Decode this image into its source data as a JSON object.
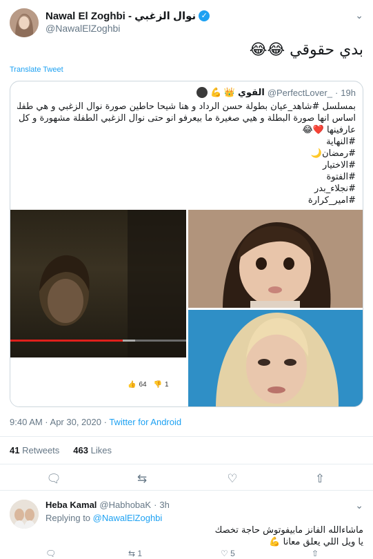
{
  "tweet": {
    "author_name": "Nawal El Zoghbi - نوال الزغبي",
    "handle": "@NawalElZoghbi",
    "text": "بدي حقوقي 😂😂",
    "translate_label": "Translate Tweet",
    "time": "9:40 AM · Apr 30, 2020",
    "source": "Twitter for Android",
    "retweets": "41",
    "retweets_label": "Retweets",
    "likes": "463",
    "likes_label": "Likes"
  },
  "quote": {
    "name": "القوي",
    "badges": "💪 👑",
    "handle": "@PerfectLover_",
    "time": "19h",
    "lines": [
      "بمسلسل #شاهد_عيان بطولة حسن الرداد و هنا شيحا حاطين صورة نوال الزغبي و هي طفلة ع",
      "اساس انها صورة البطلة و هيي صغيرة ما بيعرفو انو حتى نوال الزغبي الطفلة مشهورة و كل العالم",
      "عارفينها ❤️😂",
      "#النهاية",
      "#رمضان🌙",
      "#الاختيار",
      "#الفتوة",
      "#نجلاء_بدر",
      "#امير_كرارة"
    ],
    "video": {
      "likes": "64",
      "dislikes": "1",
      "progress": 0.64,
      "buffered": 0.71
    }
  },
  "reply": {
    "name": "Heba Kamal",
    "handle": "@HabhobaK",
    "time": "3h",
    "replying_prefix": "Replying to",
    "replying_to": "@NawalElZoghbi",
    "lines": [
      "ماشاءالله الفانز مابيفوتوش حاجة تخصك",
      "يا ويل اللي يعلق معانا 💪"
    ],
    "retweet_count": "1",
    "like_count": "5"
  },
  "colors": {
    "link": "#1da1f2",
    "muted": "#657786",
    "border": "#ccd6dd",
    "progress": "#e0201b"
  }
}
